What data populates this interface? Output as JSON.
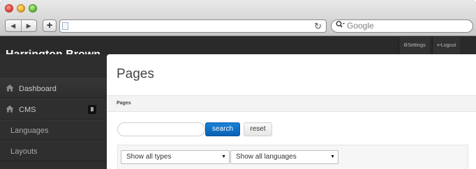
{
  "browser": {
    "search_placeholder": "Google",
    "back_glyph": "◀",
    "forward_glyph": "▶",
    "new_tab_glyph": "+",
    "reload_glyph": "↻"
  },
  "topbar": {
    "settings_label": "Settings",
    "logout_label": "Logout"
  },
  "brand": {
    "name": "Harrington Brown"
  },
  "sidebar": {
    "items": [
      {
        "label": "Dashboard",
        "icon": "home-icon"
      },
      {
        "label": "CMS",
        "icon": "home-icon",
        "badge": "8"
      },
      {
        "label": "Languages"
      },
      {
        "label": "Layouts"
      }
    ]
  },
  "main": {
    "title": "Pages",
    "breadcrumb": "Pages",
    "search_button": "search",
    "reset_button": "reset",
    "type_filter": "Show all types",
    "language_filter": "Show all languages"
  },
  "colors": {
    "accent": "#0a6cc6",
    "sidebar_bg": "#2e2e2e",
    "topbar_bg": "#2a2a2a"
  }
}
